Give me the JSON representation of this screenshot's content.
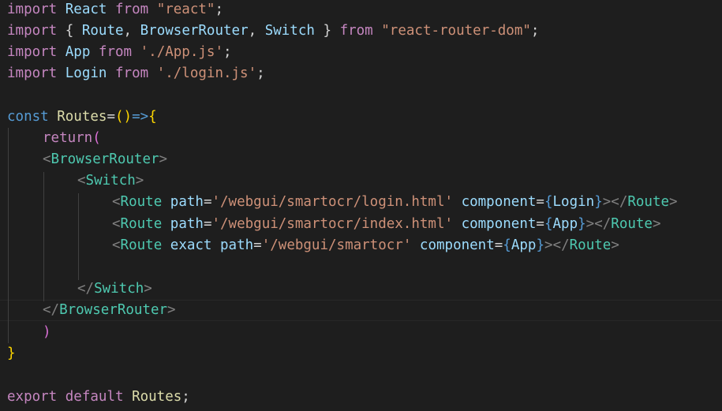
{
  "code": {
    "line1": {
      "import": "import",
      "name": "React",
      "from": "from",
      "module": "\"react\"",
      "semi": ";"
    },
    "line2": {
      "import": "import",
      "open": "{",
      "r1": "Route",
      "c1": ",",
      "r2": "BrowserRouter",
      "c2": ",",
      "r3": "Switch",
      "close": "}",
      "from": "from",
      "module": "\"react-router-dom\"",
      "semi": ";"
    },
    "line3": {
      "import": "import",
      "name": "App",
      "from": "from",
      "module": "'./App.js'",
      "semi": ";"
    },
    "line4": {
      "import": "import",
      "name": "Login",
      "from": "from",
      "module": "'./login.js'",
      "semi": ";"
    },
    "line6": {
      "const": "const",
      "name": "Routes",
      "eq": "=",
      "parens": "()",
      "arrow": "=>",
      "brace": "{"
    },
    "line7": {
      "ret": "return",
      "paren": "("
    },
    "line8": {
      "lt": "<",
      "tag": "BrowserRouter",
      "gt": ">"
    },
    "line9": {
      "lt": "<",
      "tag": "Switch",
      "gt": ">"
    },
    "line10": {
      "lt": "<",
      "tag": "Route",
      "attr1": "path",
      "eq1": "=",
      "val1": "'/webgui/smartocr/login.html'",
      "attr2": "component",
      "eq2": "=",
      "ob": "{",
      "comp": "Login",
      "cb": "}",
      "gt": ">",
      "clt": "</",
      "ctag": "Route",
      "cgt": ">"
    },
    "line11": {
      "lt": "<",
      "tag": "Route",
      "attr1": "path",
      "eq1": "=",
      "val1": "'/webgui/smartocr/index.html'",
      "attr2": "component",
      "eq2": "=",
      "ob": "{",
      "comp": "App",
      "cb": "}",
      "gt": ">",
      "clt": "</",
      "ctag": "Route",
      "cgt": ">"
    },
    "line12": {
      "lt": "<",
      "tag": "Route",
      "attr0": "exact",
      "attr1": "path",
      "eq1": "=",
      "val1": "'/webgui/smartocr'",
      "attr2": "component",
      "eq2": "=",
      "ob": "{",
      "comp": "App",
      "cb": "}",
      "gt": ">",
      "clt": "</",
      "ctag": "Route",
      "cgt": ">"
    },
    "line14": {
      "lt": "</",
      "tag": "Switch",
      "gt": ">"
    },
    "line15": {
      "lt": "</",
      "tag": "BrowserRouter",
      "gt": ">"
    },
    "line16": {
      "paren": ")"
    },
    "line17": {
      "brace": "}"
    },
    "line19": {
      "export": "export",
      "def": "default",
      "name": "Routes",
      "semi": ";"
    }
  },
  "theme": {
    "background": "#1e1e1e",
    "keyword": "#c586c0",
    "string": "#ce9178",
    "variable": "#9cdcfe",
    "component": "#4ec9b0",
    "tag_bracket": "#808080",
    "declaration": "#569cd6",
    "function": "#dcdcaa"
  }
}
